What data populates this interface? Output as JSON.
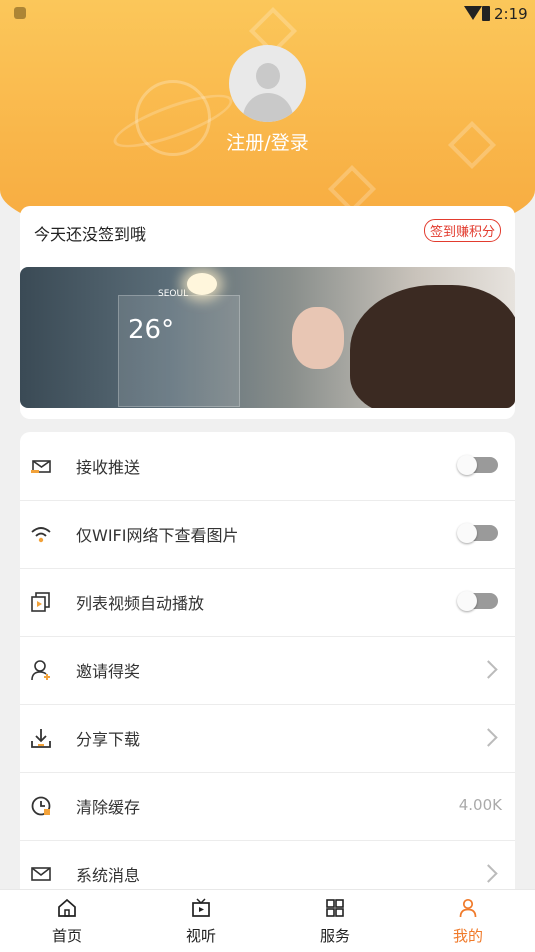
{
  "status_bar": {
    "time": "2:19",
    "icons": [
      "shield-icon",
      "wifi-icon",
      "battery-icon"
    ]
  },
  "profile": {
    "avatar": "default-avatar",
    "login_label": "注册/登录"
  },
  "signin": {
    "prompt": "今天还没签到哦",
    "button_label": "签到赚积分",
    "banner": {
      "city": "SEOUL",
      "temperature": "26°"
    }
  },
  "settings": {
    "items": [
      {
        "label": "接收推送",
        "icon": "push-mail-icon",
        "control": "toggle",
        "on": false
      },
      {
        "label": "仅WIFI网络下查看图片",
        "icon": "wifi-icon",
        "control": "toggle",
        "on": false
      },
      {
        "label": "列表视频自动播放",
        "icon": "video-play-icon",
        "control": "toggle",
        "on": false
      },
      {
        "label": "邀请得奖",
        "icon": "invite-user-icon",
        "control": "chevron"
      },
      {
        "label": "分享下载",
        "icon": "download-icon",
        "control": "chevron"
      },
      {
        "label": "清除缓存",
        "icon": "clear-cache-icon",
        "control": "value",
        "value": "4.00K"
      },
      {
        "label": "系统消息",
        "icon": "message-envelope-icon",
        "control": "chevron"
      }
    ]
  },
  "tabbar": {
    "tabs": [
      {
        "label": "首页",
        "icon": "home-icon",
        "active": false
      },
      {
        "label": "视听",
        "icon": "tv-icon",
        "active": false
      },
      {
        "label": "服务",
        "icon": "grid-icon",
        "active": false
      },
      {
        "label": "我的",
        "icon": "person-icon",
        "active": true
      }
    ],
    "active_color": "#f07a2a"
  },
  "colors": {
    "header": "#f9b64a",
    "accent": "#e23b2e"
  }
}
